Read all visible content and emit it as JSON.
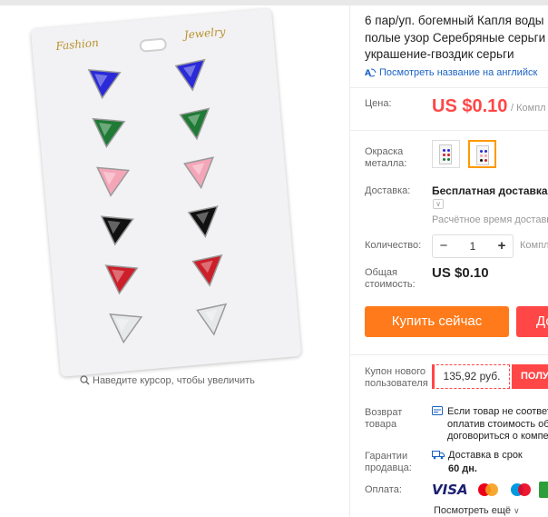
{
  "product": {
    "title_lines": [
      "6 пар/уп. богемный Капля воды",
      "полые узор Серебряные серьги д",
      "украшение-гвоздик серьги"
    ],
    "translate_link": "Посмотреть название на английск"
  },
  "gallery": {
    "card_label_left": "Fashion",
    "card_label_right": "Jewelry",
    "zoom_hint": "Наведите курсор, чтобы увеличить",
    "stone_colors": [
      "#2a2ad8",
      "#1f7a35",
      "#f4a6b8",
      "#111111",
      "#cc1f2a",
      "#e6e8ea"
    ]
  },
  "price": {
    "label": "Цена:",
    "value": "US $0.10",
    "unit": "/ Компл"
  },
  "color": {
    "label_lines": [
      "Окраска",
      "металла:"
    ],
    "selected_index": 1
  },
  "shipping": {
    "label": "Доставка:",
    "value": "Бесплатная доставка в",
    "estimate": "Расчётное время доставк"
  },
  "quantity": {
    "label": "Количество:",
    "minus": "−",
    "value": "1",
    "plus": "+",
    "unit": "Компл"
  },
  "total": {
    "label_lines": [
      "Общая",
      "стоимость:"
    ],
    "value": "US $0.10"
  },
  "actions": {
    "buy_now": "Купить сейчас",
    "add_to_cart": "До"
  },
  "coupon": {
    "label_lines": [
      "Купон нового",
      "пользователя"
    ],
    "amount": "135,92 руб.",
    "get_button": "ПОЛУЧ"
  },
  "returns": {
    "label_lines": [
      "Возврат",
      "товара"
    ],
    "text_lines": [
      "Если товар не соответ",
      "оплатив стоимость об",
      "договориться о компе"
    ]
  },
  "guarantee": {
    "label_lines": [
      "Гарантии",
      "продавца:"
    ],
    "line1": "Доставка в срок",
    "line2": "60 дн."
  },
  "payment": {
    "label": "Оплата:",
    "visa": "VISA",
    "more": "Посмотреть ещё",
    "more_icon": "chevron-down",
    "brand_colors": {
      "visa": "#1a1f71",
      "mc_red": "#eb001b",
      "mc_orange": "#f79e1b",
      "maestro_blue": "#0099df"
    }
  },
  "colors": {
    "accent_red": "#ff4747",
    "buy_orange": "#ff7a1a",
    "link_blue": "#1a62c5",
    "swatch_selected": "#ff9900"
  }
}
